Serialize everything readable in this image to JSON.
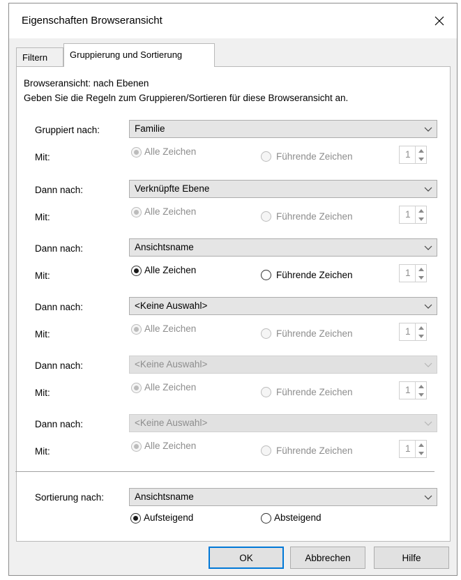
{
  "window": {
    "title": "Eigenschaften Browseransicht"
  },
  "tabs": [
    {
      "label": "Filtern",
      "active": false
    },
    {
      "label": "Gruppierung und Sortierung",
      "active": true
    }
  ],
  "intro": {
    "line1": "Browseransicht: nach Ebenen",
    "line2": "Geben Sie die Regeln zum Gruppieren/Sortieren für diese Browseransicht an."
  },
  "groups": [
    {
      "label": "Gruppiert nach:",
      "value": "Familie",
      "combo_enabled": true,
      "options_enabled": false,
      "mit_label": "Mit:",
      "all_label": "Alle Zeichen",
      "leading_label": "Führende Zeichen",
      "all_selected": true,
      "count": "1"
    },
    {
      "label": "Dann nach:",
      "value": "Verknüpfte Ebene",
      "combo_enabled": true,
      "options_enabled": false,
      "mit_label": "Mit:",
      "all_label": "Alle Zeichen",
      "leading_label": "Führende Zeichen",
      "all_selected": true,
      "count": "1"
    },
    {
      "label": "Dann nach:",
      "value": "Ansichtsname",
      "combo_enabled": true,
      "options_enabled": true,
      "mit_label": "Mit:",
      "all_label": "Alle Zeichen",
      "leading_label": "Führende Zeichen",
      "all_selected": true,
      "count": "1"
    },
    {
      "label": "Dann nach:",
      "value": "<Keine Auswahl>",
      "combo_enabled": true,
      "options_enabled": false,
      "mit_label": "Mit:",
      "all_label": "Alle Zeichen",
      "leading_label": "Führende Zeichen",
      "all_selected": true,
      "count": "1"
    },
    {
      "label": "Dann nach:",
      "value": "<Keine Auswahl>",
      "combo_enabled": false,
      "options_enabled": false,
      "mit_label": "Mit:",
      "all_label": "Alle Zeichen",
      "leading_label": "Führende Zeichen",
      "all_selected": true,
      "count": "1"
    },
    {
      "label": "Dann nach:",
      "value": "<Keine Auswahl>",
      "combo_enabled": false,
      "options_enabled": false,
      "mit_label": "Mit:",
      "all_label": "Alle Zeichen",
      "leading_label": "Führende Zeichen",
      "all_selected": true,
      "count": "1"
    }
  ],
  "sort": {
    "label": "Sortierung nach:",
    "value": "Ansichtsname",
    "ascending_label": "Aufsteigend",
    "descending_label": "Absteigend",
    "ascending_selected": true
  },
  "buttons": {
    "ok": "OK",
    "cancel": "Abbrechen",
    "help": "Hilfe"
  },
  "icons": {
    "close": "close-icon",
    "dropdown": "chevron-down-icon",
    "spin_up": "spin-up-icon",
    "spin_down": "spin-down-icon"
  },
  "colors": {
    "default_button_border": "#0078d7",
    "disabled_text": "#8d8d8d"
  }
}
